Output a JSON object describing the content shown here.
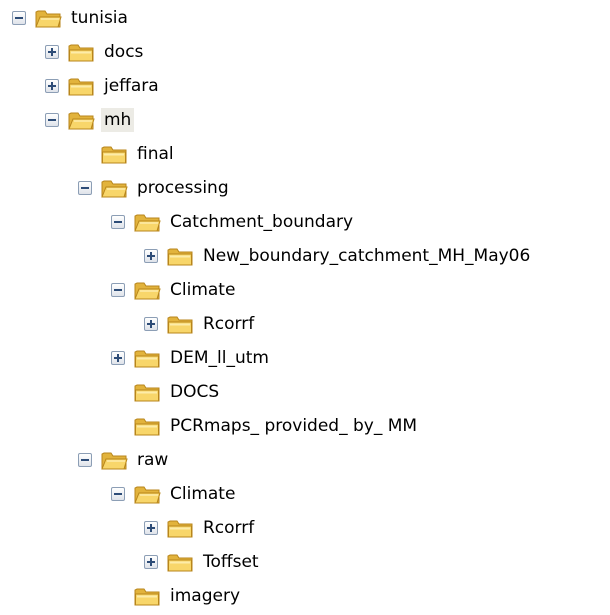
{
  "tree": {
    "nodes": [
      {
        "label": "tunisia",
        "level": 0,
        "expander": "minus",
        "open": true,
        "selected": false
      },
      {
        "label": "docs",
        "level": 1,
        "expander": "plus",
        "open": false,
        "selected": false
      },
      {
        "label": "jeffara",
        "level": 1,
        "expander": "plus",
        "open": false,
        "selected": false
      },
      {
        "label": "mh",
        "level": 1,
        "expander": "minus",
        "open": true,
        "selected": true
      },
      {
        "label": "final",
        "level": 2,
        "expander": "none",
        "open": false,
        "selected": false
      },
      {
        "label": "processing",
        "level": 2,
        "expander": "minus",
        "open": true,
        "selected": false
      },
      {
        "label": "Catchment_boundary",
        "level": 3,
        "expander": "minus",
        "open": true,
        "selected": false
      },
      {
        "label": "New_boundary_catchment_MH_May06",
        "level": 4,
        "expander": "plus",
        "open": false,
        "selected": false
      },
      {
        "label": "Climate",
        "level": 3,
        "expander": "minus",
        "open": true,
        "selected": false
      },
      {
        "label": "Rcorrf",
        "level": 4,
        "expander": "plus",
        "open": false,
        "selected": false
      },
      {
        "label": "DEM_ll_utm",
        "level": 3,
        "expander": "plus",
        "open": false,
        "selected": false
      },
      {
        "label": "DOCS",
        "level": 3,
        "expander": "none",
        "open": false,
        "selected": false
      },
      {
        "label": "PCRmaps_ provided_ by_ MM",
        "level": 3,
        "expander": "none",
        "open": false,
        "selected": false
      },
      {
        "label": "raw",
        "level": 2,
        "expander": "minus",
        "open": true,
        "selected": false
      },
      {
        "label": "Climate",
        "level": 3,
        "expander": "minus",
        "open": true,
        "selected": false
      },
      {
        "label": "Rcorrf",
        "level": 4,
        "expander": "plus",
        "open": false,
        "selected": false
      },
      {
        "label": "Toffset",
        "level": 4,
        "expander": "plus",
        "open": false,
        "selected": false
      },
      {
        "label": "imagery",
        "level": 3,
        "expander": "none",
        "open": false,
        "selected": false
      }
    ]
  },
  "colors": {
    "folder_back": "#e2b33c",
    "folder_front": "#f8d66a",
    "folder_highlight": "#fdeca9",
    "folder_outline": "#b8861b",
    "selection": "#ecebe5"
  },
  "icons": {
    "folder_closed": "folder-icon",
    "folder_open": "folder-open-icon",
    "expand": "plus-box-icon",
    "collapse": "minus-box-icon"
  }
}
